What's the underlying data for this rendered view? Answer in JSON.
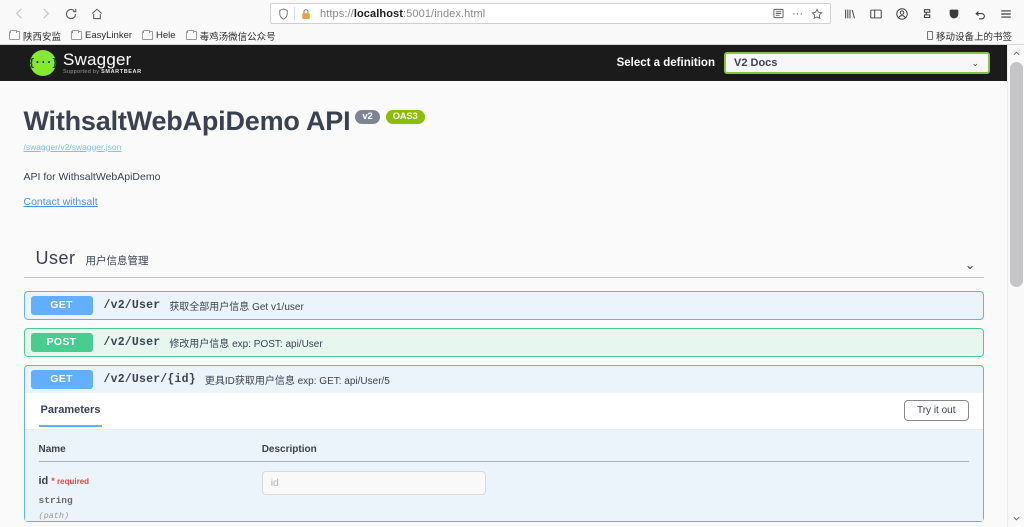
{
  "browser": {
    "nav": {
      "back_icon": "arrow-left-icon",
      "forward_icon": "arrow-right-icon",
      "reload_icon": "reload-icon",
      "home_icon": "home-icon"
    },
    "url": {
      "scheme": "https://",
      "host": "localhost",
      "rest": ":5001/index.html",
      "full": "https://localhost:5001/index.html",
      "shield_icon": "shield-icon",
      "lock_icon": "lock-icon",
      "reader_icon": "reader-view-icon",
      "more_icon": "page-actions-icon",
      "bookmark_icon": "star-icon"
    },
    "toolbar_icons": [
      "library-icon",
      "sidebar-icon",
      "account-icon",
      "container-tabs-icon",
      "pocket-icon",
      "undo-icon",
      "menu-icon"
    ],
    "bookmarks": [
      {
        "label": "陕西安监"
      },
      {
        "label": "EasyLinker"
      },
      {
        "label": "Hele"
      },
      {
        "label": "毒鸡汤微信公众号"
      }
    ],
    "mobile_bookmarks": "移动设备上的书签"
  },
  "swagger": {
    "topbar": {
      "logo_mark": "{···}",
      "logo_title": "Swagger",
      "logo_sub_prefix": "Supported by ",
      "logo_sub_brand": "SMARTBEAR",
      "definition_label": "Select a definition",
      "definition_value": "V2 Docs",
      "definition_caret": "⌄"
    },
    "info": {
      "title": "WithsaltWebApiDemo API",
      "version_badge": "v2",
      "oas_badge": "OAS3",
      "spec_url": "/swagger/v2/swagger.json",
      "description": "API for WithsaltWebApiDemo",
      "contact": "Contact withsalt"
    },
    "tag": {
      "name": "User",
      "description": "用户信息管理",
      "chevron": "⌄"
    },
    "operations": [
      {
        "method": "GET",
        "method_class": "get",
        "path": "/v2/User",
        "summary": "获取全部用户信息 Get v1/user",
        "expanded": false
      },
      {
        "method": "POST",
        "method_class": "post",
        "path": "/v2/User",
        "summary": "修改用户信息 exp: POST: api/User",
        "expanded": false
      },
      {
        "method": "GET",
        "method_class": "get",
        "path": "/v2/User/{id}",
        "summary": "更具ID获取用户信息 exp: GET: api/User/5",
        "expanded": true
      }
    ],
    "expanded_operation": {
      "tab_label": "Parameters",
      "try_it_out_label": "Try it out",
      "table_headers": {
        "name": "Name",
        "description": "Description"
      },
      "parameters": [
        {
          "name": "id",
          "required_star": "*",
          "required_label": "required",
          "type": "string",
          "location": "(path)",
          "input_value": "",
          "input_placeholder": "id"
        }
      ]
    }
  },
  "colors": {
    "get": "#61affe",
    "post": "#49cc90",
    "swagger_green": "#85ea2d",
    "topbar_bg": "#1b1b1b",
    "link": "#4990e2",
    "required_red": "#f93e3e"
  }
}
